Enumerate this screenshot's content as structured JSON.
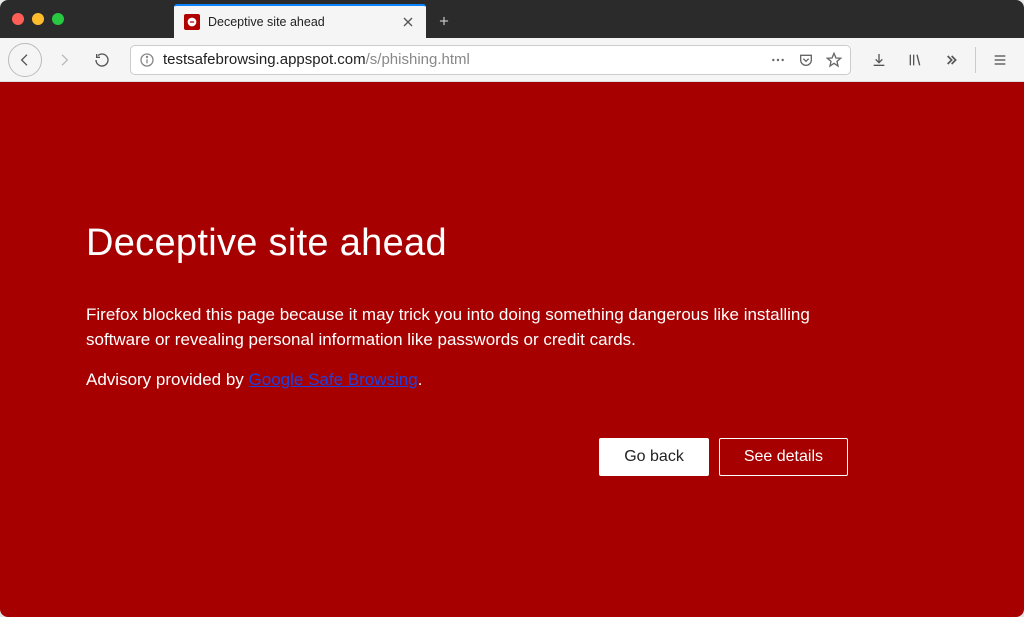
{
  "tab": {
    "title": "Deceptive site ahead"
  },
  "url": {
    "host": "testsafebrowsing.appspot.com",
    "path": "/s/phishing.html"
  },
  "warning": {
    "title": "Deceptive site ahead",
    "description": "Firefox blocked this page because it may trick you into doing something dangerous like installing software or revealing personal information like passwords or credit cards.",
    "advisory_prefix": "Advisory provided by ",
    "advisory_link_text": "Google Safe Browsing",
    "advisory_suffix": ".",
    "go_back_label": "Go back",
    "see_details_label": "See details"
  },
  "colors": {
    "warning_bg": "#a60000",
    "link_color": "#2040dd"
  }
}
